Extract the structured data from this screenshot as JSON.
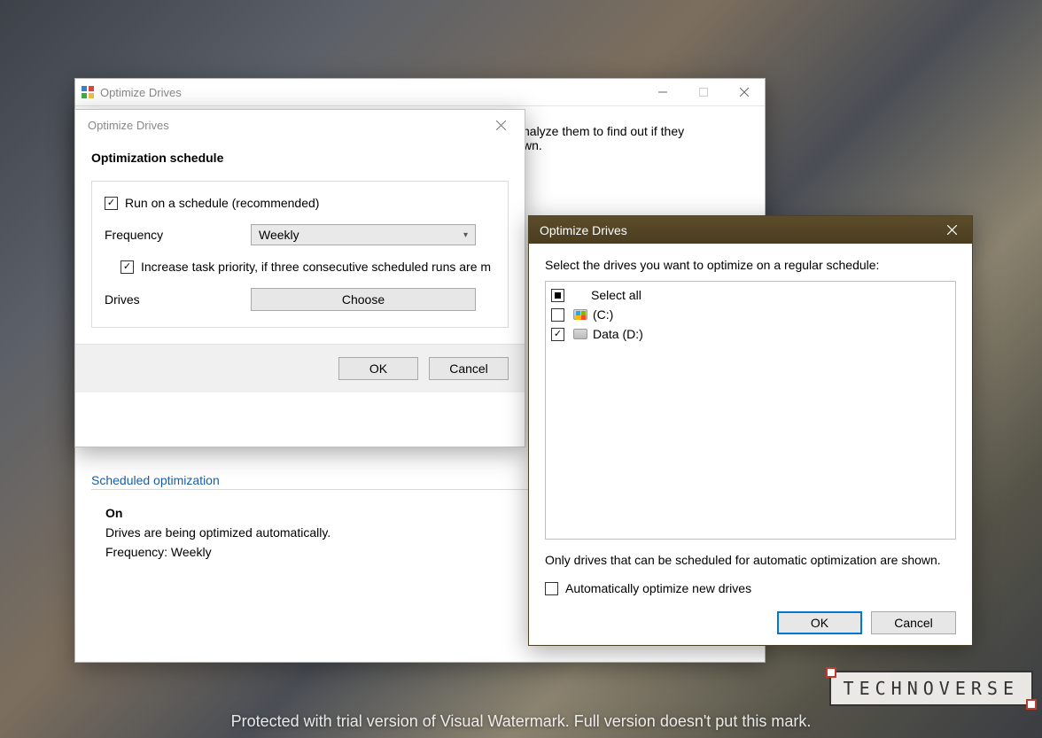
{
  "main_window": {
    "title": "Optimize Drives",
    "intro_partial_1": "nalyze them to find out if they",
    "intro_partial_2": "wn."
  },
  "schedule_dialog": {
    "title": "Optimize Drives",
    "header": "Optimization schedule",
    "run_on_schedule_label": "Run on a schedule (recommended)",
    "run_on_schedule_checked": true,
    "frequency_label": "Frequency",
    "frequency_value": "Weekly",
    "increase_priority_label": "Increase task priority, if three consecutive scheduled runs are m",
    "increase_priority_checked": true,
    "drives_label": "Drives",
    "choose_button": "Choose",
    "ok_button": "OK",
    "cancel_button": "Cancel"
  },
  "status_section": {
    "title": "Scheduled optimization",
    "state": "On",
    "line1": "Drives are being optimized automatically.",
    "line2": "Frequency: Weekly"
  },
  "choose_dialog": {
    "title": "Optimize Drives",
    "instruction": "Select the drives you want to optimize on a regular schedule:",
    "select_all_label": "Select all",
    "select_all_state": "indeterminate",
    "drives": [
      {
        "label": "(C:)",
        "checked": false,
        "icon": "windows"
      },
      {
        "label": "Data (D:)",
        "checked": true,
        "icon": "hdd"
      }
    ],
    "note": "Only drives that can be scheduled for automatic optimization are shown.",
    "auto_new_label": "Automatically optimize new drives",
    "auto_new_checked": false,
    "ok_button": "OK",
    "cancel_button": "Cancel"
  },
  "branding": {
    "logo": "TECHNOVERSE",
    "watermark": "Protected with trial version of Visual Watermark. Full version doesn't put this mark."
  }
}
